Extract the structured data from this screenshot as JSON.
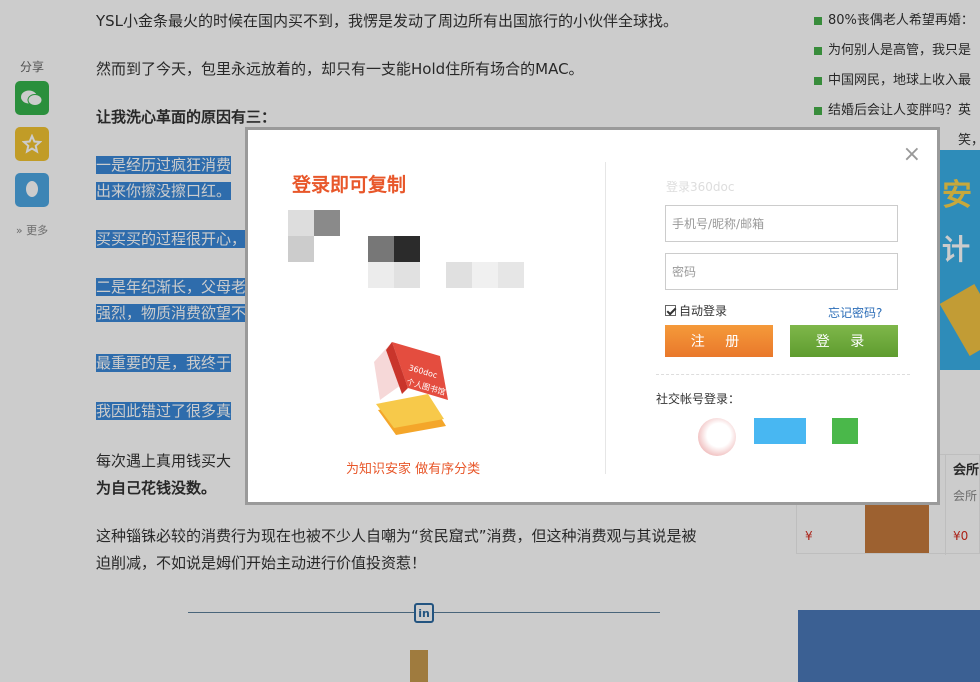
{
  "share": {
    "label": "分享",
    "more": "更多"
  },
  "article": {
    "p1": "YSL小金条最火的时候在国内买不到，我愣是发动了周边所有出国旅行的小伙伴全球找。",
    "p2": "然而到了今天，包里永远放着的，却只有一支能Hold住所有场合的MAC。",
    "p3": "让我洗心革面的原因有三：",
    "h1a": "一是经历过疯狂消费",
    "h1b": "出来你擦没擦口红。",
    "h2": "买买买的过程很开心，",
    "h3a": "二是年纪渐长，父母老",
    "h3b": "强烈，物质消费欲望不",
    "h4": "最重要的是，我终于",
    "h5": "我因此错过了很多真",
    "p4a": "每次遇上真用钱买大",
    "p4b": "为自己花钱没数。",
    "p5a": "这种锱铢必较的消费行为现在也被不少人自嘲为“贫民窟式”消费，但这种消费观与其说是被",
    "p5b": "迫削减，不如说是姆们开始主动进行价值投资惹！",
    "linkedin": "in"
  },
  "sidebar": {
    "items": [
      "80%丧偶老人希望再婚：",
      "为何别人是高管，我只是",
      "中国网民，地球上收入最",
      "结婚后会让人变胖吗？英",
      "笑，不"
    ],
    "product": {
      "title": "会所",
      "subtitle": "会所",
      "price1": "¥",
      "price2": "¥0"
    }
  },
  "modal": {
    "left_title": "登录即可复制",
    "book_label_1": "360doc",
    "book_label_2": "个人图书馆",
    "slogan": "为知识安家  做有序分类",
    "form_title": "登录360doc",
    "username_placeholder": "手机号/昵称/邮箱",
    "password_placeholder": "密码",
    "auto_login": "自动登录",
    "forgot": "忘记密码?",
    "register": "注 册",
    "login": "登 录",
    "social_label": "社交帐号登录：",
    "close": "×"
  },
  "colors": {
    "accent_orange": "#e8572a",
    "register": "#ef8a32",
    "login": "#6ca83a",
    "highlight": "#3a88d8",
    "link": "#2c6eb8"
  }
}
